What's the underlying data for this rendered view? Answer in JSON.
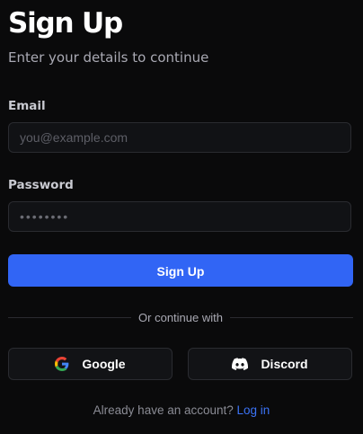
{
  "header": {
    "title": "Sign Up",
    "subtitle": "Enter your details to continue"
  },
  "form": {
    "email_label": "Email",
    "email_placeholder": "you@example.com",
    "email_value": "",
    "password_label": "Password",
    "password_value": "••••••••",
    "submit_label": "Sign Up"
  },
  "divider": {
    "text": "Or continue with"
  },
  "oauth": {
    "google": {
      "label": "Google",
      "icon": "google-icon"
    },
    "discord": {
      "label": "Discord",
      "icon": "discord-icon"
    }
  },
  "footer": {
    "prompt": "Already have an account?",
    "link": "Log in"
  },
  "colors": {
    "background": "#0a0a0b",
    "primary": "#3165f5",
    "link": "#3b73f6",
    "input_bg": "#111215",
    "border": "#2a2b30"
  }
}
